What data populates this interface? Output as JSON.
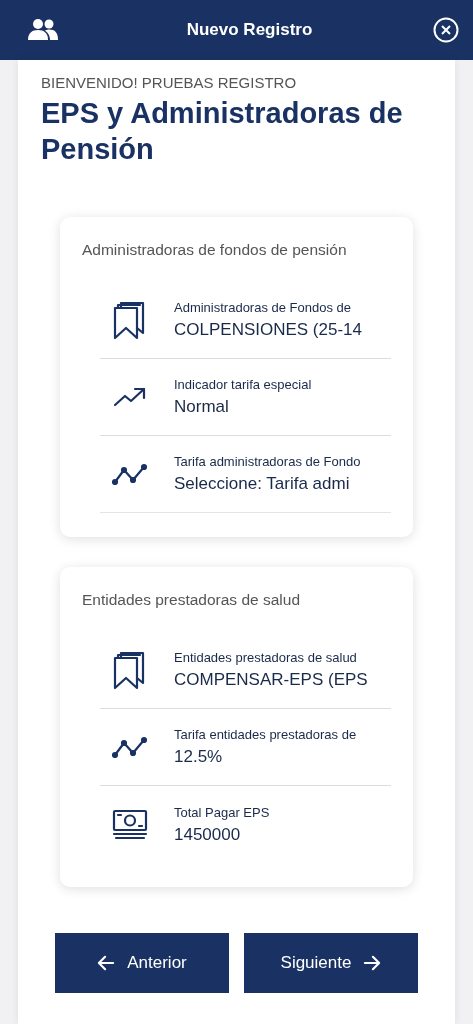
{
  "header": {
    "title": "Nuevo Registro"
  },
  "greeting": "BIENVENIDO! PRUEBAS REGISTRO",
  "heading": "EPS y Administradoras de Pensión",
  "cards": [
    {
      "title": "Administradoras de fondos de pensión",
      "rows": [
        {
          "kind": "bookmarks",
          "label": "Administradoras de Fondos de",
          "value": "COLPENSIONES (25-14"
        },
        {
          "kind": "trend",
          "label": "Indicador tarifa especial",
          "value": "Normal"
        },
        {
          "kind": "chart",
          "label": "Tarifa administradoras de Fondo",
          "value": "Seleccione: Tarifa admi"
        }
      ]
    },
    {
      "title": "Entidades prestadoras de salud",
      "rows": [
        {
          "kind": "bookmarks",
          "label": "Entidades prestadoras de salud",
          "value": "COMPENSAR-EPS (EPS"
        },
        {
          "kind": "chart",
          "label": "Tarifa entidades prestadoras de",
          "value": "12.5%"
        },
        {
          "kind": "money",
          "label": "Total Pagar EPS",
          "value": "1450000"
        }
      ]
    }
  ],
  "buttons": [
    {
      "kind": "back",
      "label": "Anterior"
    },
    {
      "kind": "next",
      "label": "Siguiente"
    }
  ]
}
